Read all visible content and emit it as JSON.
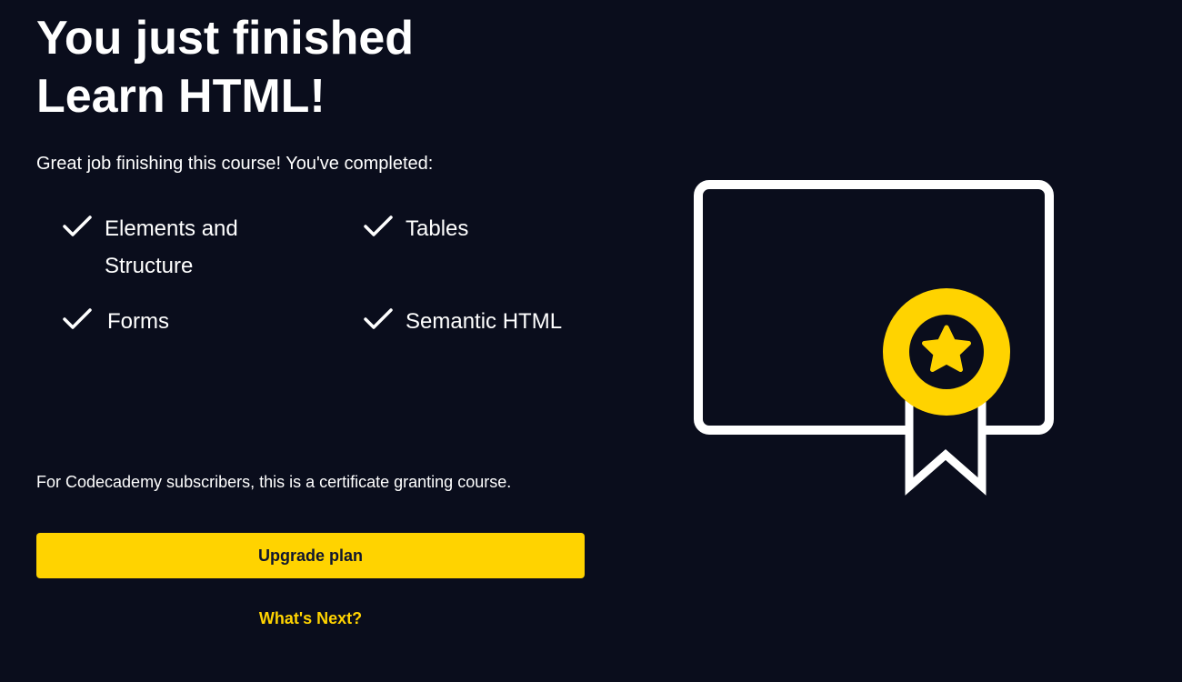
{
  "heading": {
    "line1": "You just finished",
    "line2": "Learn HTML!"
  },
  "subtitle": "Great job finishing this course! You've completed:",
  "modules": [
    {
      "label": "Elements and Structure",
      "completed": true,
      "icon": "checkmark-icon"
    },
    {
      "label": "Tables",
      "completed": true,
      "icon": "checkmark-icon"
    },
    {
      "label": "Forms",
      "completed": true,
      "icon": "checkmark-icon"
    },
    {
      "label": "Semantic HTML",
      "completed": true,
      "icon": "checkmark-icon"
    }
  ],
  "note": "For Codecademy subscribers, this is a certificate granting course.",
  "actions": {
    "upgrade_label": "Upgrade plan",
    "whats_next_label": "What's Next?"
  },
  "illustration": {
    "icon": "certificate-icon",
    "badge_icon": "star-badge-icon"
  },
  "colors": {
    "background": "#0a0d1c",
    "text": "#ffffff",
    "accent": "#ffd300",
    "button_text": "#10162f"
  }
}
